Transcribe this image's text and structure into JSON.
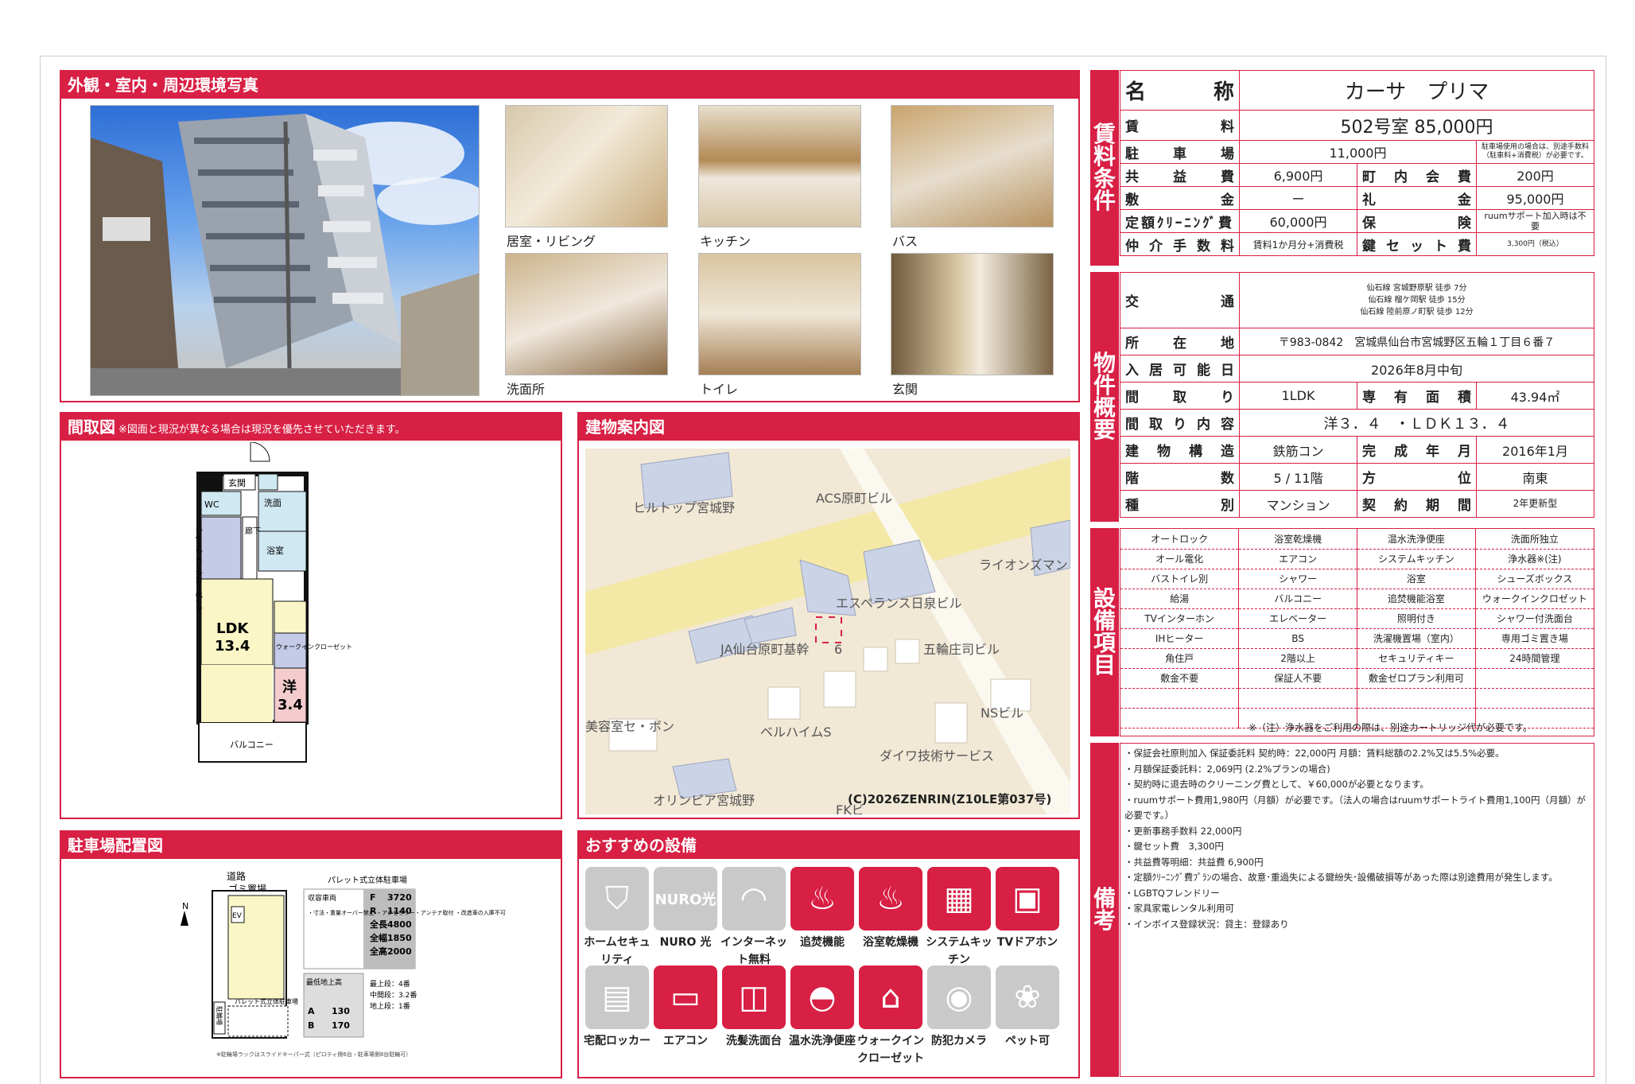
{
  "photos": {
    "title": "外観・室内・周辺環境写真",
    "captions": [
      "居室・リビング",
      "キッチン",
      "バス",
      "洗面所",
      "トイレ",
      "玄関"
    ]
  },
  "floorplan": {
    "title": "間取図",
    "note": "※図面と現況が異なる場合は現況を優先させていただきます。",
    "labels": {
      "genkan": "玄関",
      "wc": "WC",
      "senmen": "洗面",
      "rouka": "廊下",
      "walkin1": "ウォークインクローゼット",
      "yokushitsu": "浴室",
      "ldk": "LDK",
      "ldk_size": "13.4",
      "walkin2": "ウォークインクローゼット",
      "you": "洋",
      "you_size": "3.4",
      "balcony": "バルコニー"
    }
  },
  "map": {
    "title": "建物案内図",
    "labels": [
      "ヒルトップ宮城野",
      "ACS原町ビル",
      "ライオンズマン",
      "エスペランス日泉ビル",
      "JA仙台原町基幹",
      "6",
      "五輪庄司ビル",
      "NSビル",
      "美容室セ・ボン",
      "ベルハイムS",
      "ダイワ技術サービス",
      "オリンピア宮城野",
      "FKビ"
    ],
    "copyright": "(C)2026ZENRIN(Z10LE第037号)"
  },
  "parking": {
    "title": "駐車場配置図",
    "road": "道路",
    "gomi": "ゴミ置場",
    "ev": "EV",
    "chusha": "駐輪場",
    "pallet_title": "パレット式立体駐車場",
    "pallet_label": "パレット式立体駐車場",
    "spec_title": "収容車両",
    "specs": [
      [
        "F",
        "3720"
      ],
      [
        "R",
        "1140"
      ],
      [
        "全長",
        "4800"
      ],
      [
        "全幅",
        "1850"
      ],
      [
        "全高",
        "2000"
      ]
    ],
    "spec_note": "・寸法・重量オーバー禁止 ・アクセサリー・アンテナ取付 ・改造車の入庫不可",
    "min_title": "最低地上高",
    "levels": [
      "最上段：4番",
      "中間段：3.2番",
      "地上段：1番"
    ],
    "mins": [
      [
        "A",
        "130"
      ],
      [
        "B",
        "170"
      ]
    ],
    "footnote": "※駐輪場ラックはスライドキーパー式（ピロティ側6台・駐車場側8台駐輪可）",
    "north": "N"
  },
  "osusume": {
    "title": "おすすめの設備",
    "row1": [
      {
        "label": "ホームセキュリティ",
        "on": false,
        "icon": "shield-icon"
      },
      {
        "label": "NURO 光",
        "on": false,
        "icon": "nuro-icon",
        "text": "NURO光"
      },
      {
        "label": "インターネット無料",
        "on": false,
        "icon": "wifi-icon"
      },
      {
        "label": "追焚機能",
        "on": true,
        "icon": "bathtub-icon"
      },
      {
        "label": "浴室乾燥機",
        "on": true,
        "icon": "bath-dryer-icon"
      },
      {
        "label": "システムキッチン",
        "on": true,
        "icon": "kitchen-icon"
      },
      {
        "label": "TVドアホン",
        "on": true,
        "icon": "intercom-icon"
      }
    ],
    "row2": [
      {
        "label": "宅配ロッカー",
        "on": false,
        "icon": "locker-icon"
      },
      {
        "label": "エアコン",
        "on": true,
        "icon": "aircon-icon"
      },
      {
        "label": "洗髪洗面台",
        "on": true,
        "icon": "washbasin-icon"
      },
      {
        "label": "温水洗浄便座",
        "on": true,
        "icon": "toilet-icon"
      },
      {
        "label": "ウォークインクローゼット",
        "on": true,
        "icon": "closet-icon"
      },
      {
        "label": "防犯カメラ",
        "on": false,
        "icon": "camera-icon"
      },
      {
        "label": "ペット可",
        "on": false,
        "icon": "paw-icon"
      }
    ]
  },
  "rent": {
    "side": "賃料条件",
    "name_k": "名　　称",
    "name_v": "カーサ　プリマ",
    "chinryo_k": "賃　　料",
    "chinryo_v": "502号室 85,000円",
    "parking_k": "駐車場",
    "parking_v": "11,000円",
    "parking_note": "駐車場使用の場合は、別途手数料（駐車料+消費税）が必要です。",
    "kyoeki_k": "共益費",
    "kyoeki_v": "6,900円",
    "chonai_k": "町内会費",
    "chonai_v": "200円",
    "shiki_k": "敷金",
    "shiki_v": "ー",
    "rei_k": "礼金",
    "rei_v": "95,000円",
    "clean_k": "定額ｸﾘｰﾆﾝｸﾞ費",
    "clean_v": "60,000円",
    "hoken_k": "保険",
    "hoken_v": "ruumサポート加入時は不要",
    "chukai_k": "仲介手数料",
    "chukai_v": "賃料1か月分+消費税",
    "kagi_k": "鍵セット費",
    "kagi_v": "3,300円（税込）"
  },
  "bukken": {
    "side": "物件概要",
    "kotsu_k": "交通",
    "kotsu_v": [
      "仙石線 宮城野原駅 徒歩 7分",
      "仙石線 榴ケ岡駅 徒歩 15分",
      "仙石線 陸前原ノ町駅 徒歩 12分"
    ],
    "shozai_k": "所在地",
    "shozai_v": "〒983-0842　宮城県仙台市宮城野区五輪１丁目６番７",
    "nyukyo_k": "入居可能日",
    "nyukyo_v": "2026年8月中旬",
    "madori_k": "間取り",
    "madori_v": "1LDK",
    "menseki_k": "専有面積",
    "menseki_v": "43.94㎡",
    "naiyo_k": "間取り内容",
    "naiyo_v": "洋３．４　・ＬＤＫ１３．４",
    "kozo_k": "建物構造",
    "kozo_v": "鉄筋コン",
    "kansei_k": "完成年月",
    "kansei_v": "2016年1月",
    "kaisu_k": "階数",
    "kaisu_v": "5 / 11階",
    "hoi_k": "方位",
    "hoi_v": "南東",
    "shubetsu_k": "種別",
    "shubetsu_v": "マンション",
    "keiyaku_k": "契約期間",
    "keiyaku_v": "2年更新型"
  },
  "setsubi": {
    "side": "設備項目",
    "rows": [
      [
        "オートロック",
        "浴室乾燥機",
        "温水洗浄便座",
        "洗面所独立"
      ],
      [
        "オール電化",
        "エアコン",
        "システムキッチン",
        "浄水器※(注)"
      ],
      [
        "バストイレ別",
        "シャワー",
        "浴室",
        "シューズボックス"
      ],
      [
        "給湯",
        "バルコニー",
        "追焚機能浴室",
        "ウォークインクロゼット"
      ],
      [
        "TVインターホン",
        "エレベーター",
        "照明付き",
        "シャワー付洗面台"
      ],
      [
        "IHヒーター",
        "BS",
        "洗濯機置場（室内）",
        "専用ゴミ置き場"
      ],
      [
        "角住戸",
        "2階以上",
        "セキュリティキー",
        "24時間管理"
      ],
      [
        "敷金不要",
        "保証人不要",
        "敷金ゼロプラン利用可",
        ""
      ],
      [
        "",
        "",
        "",
        ""
      ],
      [
        "",
        "",
        "",
        ""
      ]
    ],
    "note": "※（注）浄水器をご利用の際は、別途カートリッジ代が必要です。"
  },
  "biko": {
    "side": "備考",
    "items": [
      "・保証会社原則加入 保証委託料 契約時：22,000円 月額：賃料総額の2.2%又は5.5%必要。",
      "・月額保証委託料：2,069円 (2.2%プランの場合)",
      "・契約時に退去時のクリーニング費として、￥60,000が必要となります。",
      "・ruumサポート費用1,980円（月額）が必要です。（法人の場合はruumサポートライト費用1,100円（月額）が必要です。）",
      "・更新事務手数料 22,000円",
      "・鍵セット費　3,300円",
      "・共益費等明細：共益費 6,900円",
      "・定額ｸﾘｰﾆﾝｸﾞ費ﾌﾟﾗﾝの場合、故意･重過失による鍵紛失･設備破損等があった際は別途費用が発生します。",
      "・LGBTQフレンドリー",
      "・家具家電レンタル利用可",
      "・インボイス登録状況：貸主：登録あり"
    ]
  }
}
